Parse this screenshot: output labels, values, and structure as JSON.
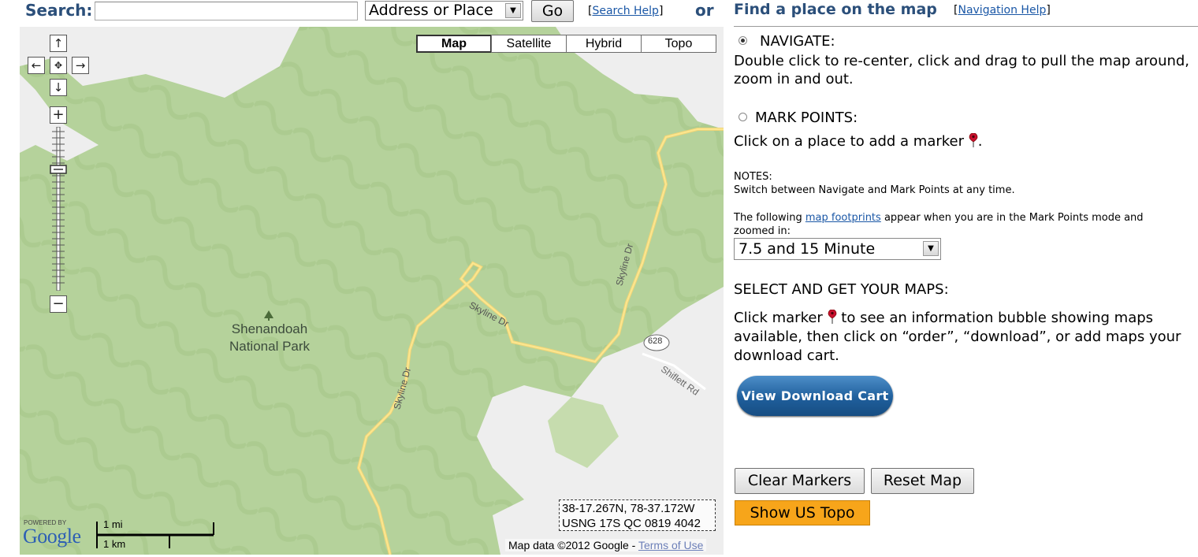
{
  "search": {
    "label": "Search:",
    "value": "",
    "type_selected": "Address or Place",
    "go_label": "Go",
    "help_open": "[",
    "help_link": "Search Help",
    "help_close": "]",
    "or_label": "or"
  },
  "map": {
    "types": [
      "Map",
      "Satellite",
      "Hybrid",
      "Topo"
    ],
    "active_type": "Map",
    "labels": {
      "park_line1": "Shenandoah",
      "park_line2": "National Park",
      "road1": "Skyline Dr",
      "road2": "Skyline Dr",
      "road3": "Skyline Dr",
      "road4": "Shiflett Rd",
      "route_shield": "628"
    },
    "coords_line1": "38-17.267N, 78-37.172W",
    "coords_line2": "USNG 17S QC 0819 4042",
    "scale_mi": "1 mi",
    "scale_km": "1 km",
    "powered_by": "POWERED BY",
    "google_logo": "Google",
    "attribution": "Map data ©2012 Google - ",
    "terms_link": "Terms of Use"
  },
  "panel": {
    "title": "Find a place on the map",
    "nav_help_open": "[",
    "nav_help_link": "Navigation Help",
    "nav_help_close": "]",
    "navigate_label": "NAVIGATE:",
    "navigate_desc": "Double click to re-center, click and drag to pull the map around, zoom in and out.",
    "mark_label": "MARK POINTS:",
    "mark_desc": "Click on a place to add a marker",
    "mark_desc_end": ".",
    "notes_title": "NOTES:",
    "notes_text": "Switch between Navigate and Mark Points at any time.",
    "footprints_pre": "The following ",
    "footprints_link": "map footprints",
    "footprints_post": " appear when you are in the Mark Points mode and zoomed in:",
    "footprint_selected": "7.5 and 15 Minute",
    "select_title": "SELECT AND GET YOUR MAPS:",
    "select_pre": "Click marker",
    "select_post": " to see an information bubble showing maps available, then click on “order”, “download”, or add maps your download cart.",
    "cart_button": "View Download Cart",
    "clear_button": "Clear Markers",
    "reset_button": "Reset Map",
    "topo_button": "Show US Topo"
  },
  "colors": {
    "forest": "#b5d29b",
    "open_land": "#eeeeee",
    "road": "#f9dd7a",
    "heading": "#2b4f7a",
    "link": "#1a57a6",
    "topo_button": "#f7a51a"
  }
}
